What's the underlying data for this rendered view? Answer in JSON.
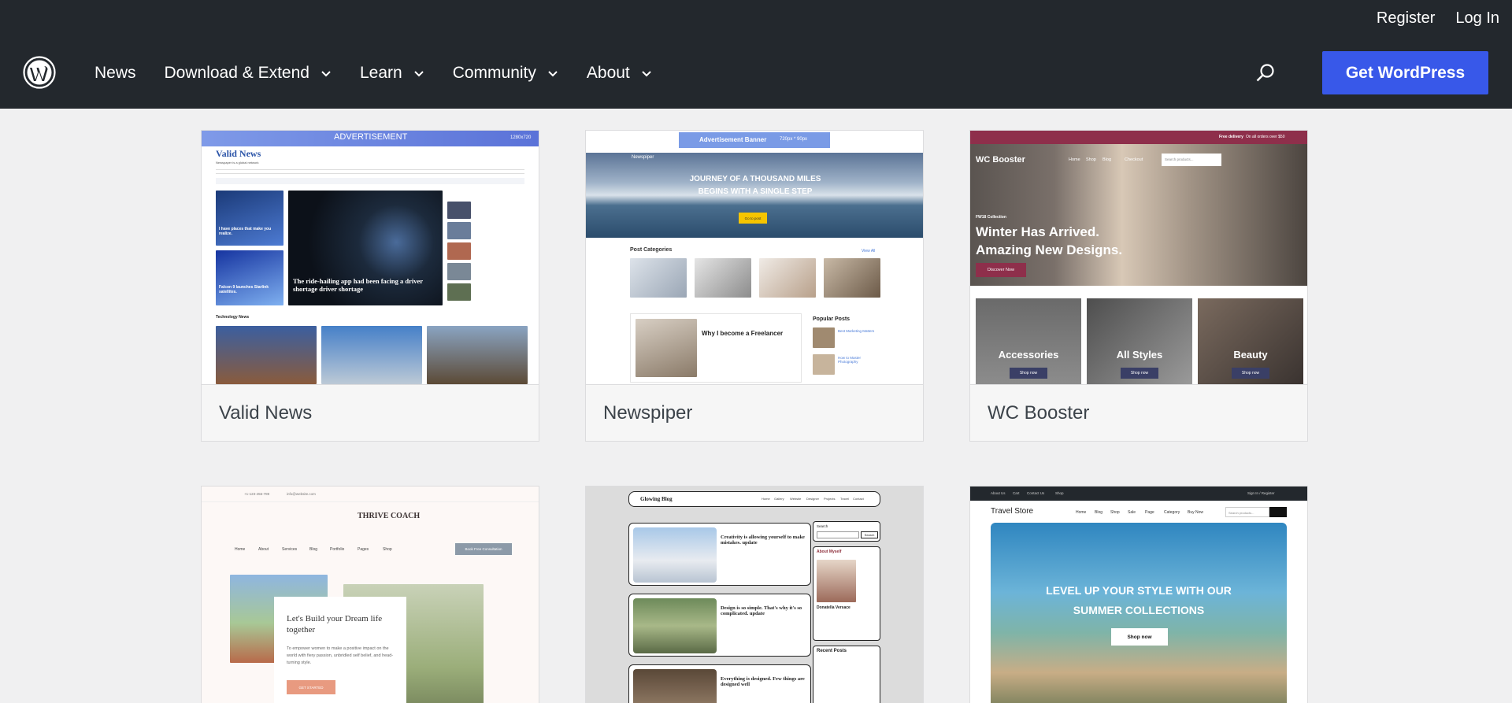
{
  "header": {
    "auth": {
      "register": "Register",
      "login": "Log In"
    },
    "nav": [
      {
        "label": "News",
        "has_dropdown": false
      },
      {
        "label": "Download & Extend",
        "has_dropdown": true
      },
      {
        "label": "Learn",
        "has_dropdown": true
      },
      {
        "label": "Community",
        "has_dropdown": true
      },
      {
        "label": "About",
        "has_dropdown": true
      }
    ],
    "cta": "Get WordPress",
    "colors": {
      "bar": "#23282d",
      "cta": "#3858e9"
    }
  },
  "themes": [
    {
      "name": "Valid News",
      "preview": {
        "banner": "ADVERTISEMENT",
        "banner_size": "1280x720",
        "site_title": "Valid News",
        "tagline": "Newspaper is a global network",
        "headline": "The ride-hailing app had been facing a driver shortage driver shortage",
        "section": "Technology News",
        "side_items": [
          "I have places that make you realize.",
          "Falcon 9 launches Starlink satellites."
        ]
      }
    },
    {
      "name": "Newspiper",
      "preview": {
        "banner": "Advertisement Banner",
        "banner_size": "720px * 90px",
        "site_title": "Newspiper",
        "hero_line1": "JOURNEY OF A THOUSAND MILES",
        "hero_line2": "BEGINS WITH A SINGLE STEP",
        "hero_button": "Go to post",
        "categories_title": "Post Categories",
        "view_all": "View All",
        "post_title": "Why I become a Freelancer",
        "popular_title": "Popular Posts",
        "popular_items": [
          "Best Marketing Matters",
          "How to Master Photography"
        ]
      }
    },
    {
      "name": "WC Booster",
      "preview": {
        "site_title": "WC Booster",
        "nav": [
          "Home",
          "Shop",
          "Blog",
          "Checkout"
        ],
        "search_placeholder": "Search products...",
        "promo": "Free delivery",
        "promo_detail": "On all orders over $50",
        "kicker": "FW18 Collection",
        "hero_line1": "Winter Has Arrived.",
        "hero_line2": "Amazing New Designs.",
        "hero_button": "Discover Now",
        "tiles": [
          "Accessories",
          "All Styles",
          "Beauty"
        ],
        "tile_button": "Shop now"
      }
    },
    {
      "name": "Thrive Coach",
      "preview": {
        "phone": "+1-123-456-789",
        "email": "info@website.com",
        "site_title": "THRIVE COACH",
        "nav": [
          "Home",
          "About",
          "Services",
          "Blog",
          "Portfolio",
          "Pages",
          "Shop"
        ],
        "nav_button": "Book Free Consultation",
        "heading": "Let's Build your Dream life together",
        "body": "To empower women to make a positive impact on the world with fiery passion, unbridled self belief, and head-turning style.",
        "button": "GET STARTED"
      }
    },
    {
      "name": "Glowing Blog",
      "preview": {
        "site_title": "Glowing Blog",
        "nav": [
          "Home",
          "Gallery",
          "Website",
          "Designer",
          "Projects",
          "Travel",
          "Contact"
        ],
        "posts": [
          "Creativity is allowing yourself to make mistakes. update",
          "Design is so simple. That's why it's so complicated. update",
          "Everything is designed. Few things are designed well"
        ],
        "search_label": "Search",
        "search_button": "Search",
        "about_title": "About Myself",
        "about_name": "Donatella Versace",
        "recent_title": "Recent Posts"
      }
    },
    {
      "name": "Travel Store",
      "preview": {
        "topnav": [
          "About Us",
          "Cart",
          "Contact Us",
          "Shop"
        ],
        "account": "Sign In / Register",
        "site_title": "Travel Store",
        "nav": [
          "Home",
          "Blog",
          "Shop",
          "Sale",
          "Page",
          "Category",
          "Buy Now"
        ],
        "search_placeholder": "Search products...",
        "hero_line1": "LEVEL UP YOUR STYLE WITH OUR",
        "hero_line2": "SUMMER COLLECTIONS",
        "hero_button": "Shop now"
      }
    }
  ]
}
